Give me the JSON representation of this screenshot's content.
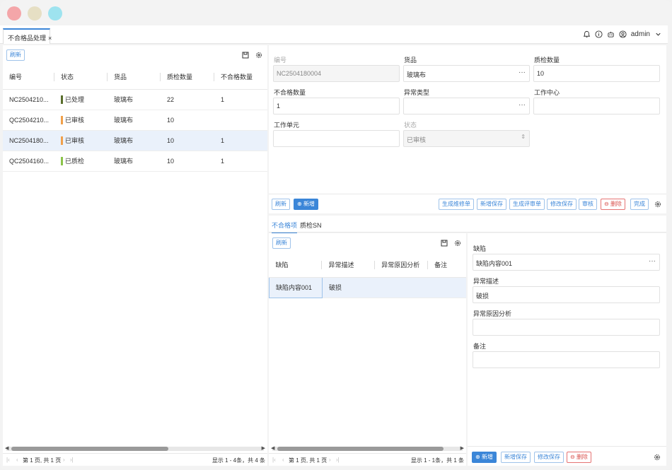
{
  "window": {
    "lights": {
      "red": "#f4a6a9",
      "yellow": "#e6dfc4",
      "cyan": "#9ee3ef"
    }
  },
  "tab": {
    "label": "不合格品处理",
    "close": "×"
  },
  "header": {
    "user": "admin"
  },
  "left": {
    "refresh_label": "刷新",
    "columns": [
      "编号",
      "状态",
      "货品",
      "质检数量",
      "不合格数量"
    ],
    "rows": [
      {
        "code": "NC2504210...",
        "status": "已处理",
        "status_color": "#5a6e2c",
        "item": "玻璃布",
        "qty": "22",
        "bad": "1"
      },
      {
        "code": "QC2504210...",
        "status": "已审核",
        "status_color": "#f0a04b",
        "item": "玻璃布",
        "qty": "10",
        "bad": ""
      },
      {
        "code": "NC2504180...",
        "status": "已审核",
        "status_color": "#f0a04b",
        "item": "玻璃布",
        "qty": "10",
        "bad": "1"
      },
      {
        "code": "QC2504160...",
        "status": "已质检",
        "status_color": "#8bc34a",
        "item": "玻璃布",
        "qty": "10",
        "bad": "1"
      }
    ],
    "pager": "第 1 页, 共 1 页",
    "summary": "显示 1 - 4条，共 4 条"
  },
  "form": {
    "code_label": "编号",
    "code_value": "NC2504180004",
    "item_label": "货品",
    "item_value": "玻璃布",
    "qty_label": "质检数量",
    "qty_value": "10",
    "bad_label": "不合格数量",
    "bad_value": "1",
    "abn_label": "异常类型",
    "abn_value": "",
    "wc_label": "工作中心",
    "wc_value": "",
    "wu_label": "工作单元",
    "wu_value": "",
    "status_label": "状态",
    "status_value": "已审核"
  },
  "toolbar": {
    "refresh": "刷新",
    "add": "新增",
    "gen_repair": "生成维修单",
    "save_new": "新增保存",
    "gen_review": "生成评审单",
    "save_edit": "修改保存",
    "audit": "审核",
    "delete": "删除",
    "done": "完成"
  },
  "subtabs": [
    "不合格项",
    "质检SN"
  ],
  "sub": {
    "refresh_label": "刷新",
    "columns": [
      "缺陷",
      "异常描述",
      "异常原因分析",
      "备注"
    ],
    "rows": [
      {
        "defect": "缺陷内容001",
        "desc": "破损",
        "cause": "",
        "note": ""
      }
    ],
    "pager": "第 1 页, 共 1 页",
    "summary": "显示 1 - 1条，共 1 条"
  },
  "detail": {
    "defect_label": "缺陷",
    "defect_value": "缺陷内容001",
    "desc_label": "异常描述",
    "desc_value": "破损",
    "cause_label": "异常原因分析",
    "cause_value": "",
    "note_label": "备注",
    "note_value": ""
  },
  "detail_toolbar": {
    "add": "新增",
    "save_new": "新增保存",
    "save_edit": "修改保存",
    "delete": "删除"
  }
}
